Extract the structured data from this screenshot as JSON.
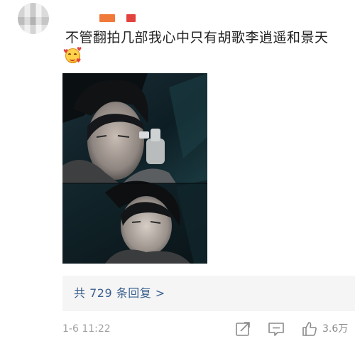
{
  "comment": {
    "text": "不管翻拍几部我心中只有胡歌李逍遥和景天",
    "emoji": "heart-eyes-emoji"
  },
  "replies": {
    "label": "共 729 条回复 >"
  },
  "footer": {
    "timestamp": "1-6 11:22",
    "like_count": "3.6万"
  },
  "icons": {
    "share": "share-icon",
    "comment": "comment-icon",
    "like": "thumbs-up-icon"
  },
  "colors": {
    "link": "#3a5f8f",
    "meta_text": "#a0a0a0",
    "reply_box_bg": "#f5f5f5",
    "blur_orange": "#f07a3a",
    "blur_red": "#e2433f"
  }
}
